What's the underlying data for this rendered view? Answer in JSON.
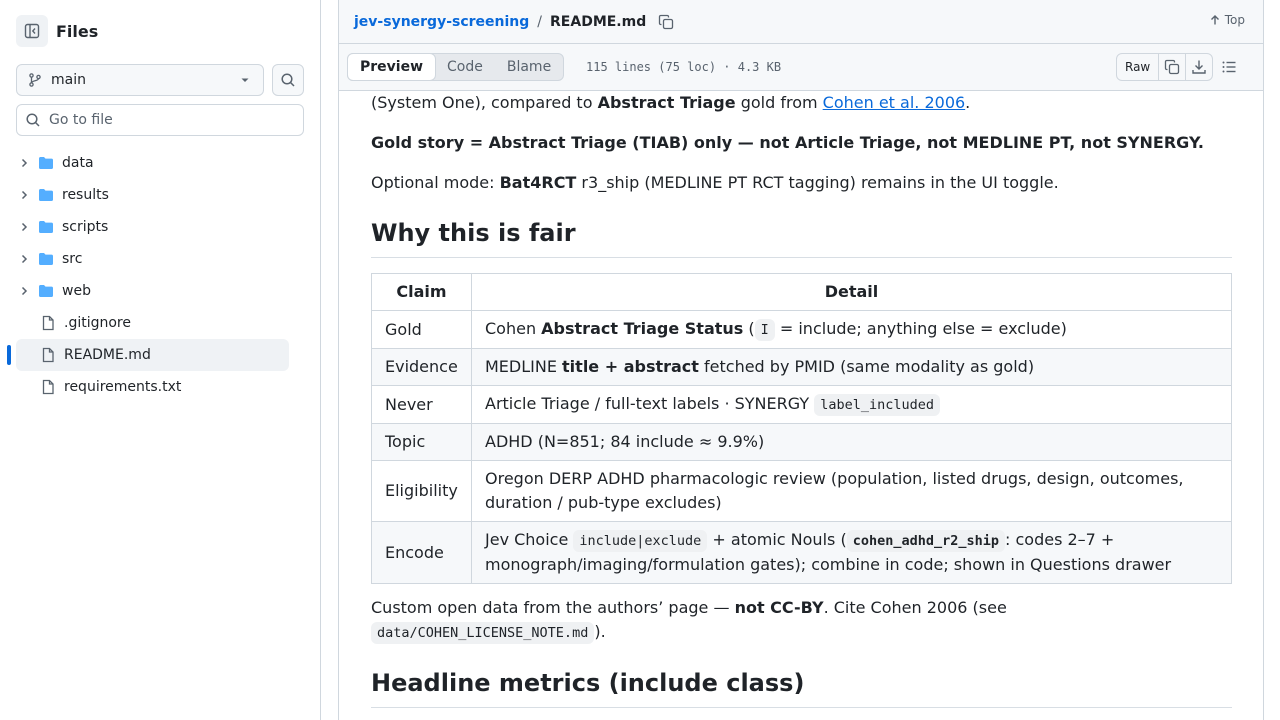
{
  "sidebar": {
    "title": "Files",
    "branch": "main",
    "goto_placeholder": "Go to file",
    "tree": [
      {
        "type": "folder",
        "name": "data"
      },
      {
        "type": "folder",
        "name": "results"
      },
      {
        "type": "folder",
        "name": "scripts"
      },
      {
        "type": "folder",
        "name": "src"
      },
      {
        "type": "folder",
        "name": "web"
      },
      {
        "type": "file",
        "name": ".gitignore"
      },
      {
        "type": "file",
        "name": "README.md",
        "active": true
      },
      {
        "type": "file",
        "name": "requirements.txt"
      }
    ]
  },
  "header": {
    "repo": "jev-synergy-screening",
    "sep": "/",
    "file": "README.md",
    "top": "Top"
  },
  "toolbar": {
    "tabs": [
      "Preview",
      "Code",
      "Blame"
    ],
    "active_tab": "Preview",
    "fileinfo": "115 lines (75 loc) · 4.3 KB",
    "raw": "Raw"
  },
  "readme": {
    "p1": {
      "a": "(System One), compared to ",
      "b": "Abstract Triage",
      "c": " gold from ",
      "link": "Cohen et al. 2006",
      "d": "."
    },
    "p2": "Gold story = Abstract Triage (TIAB) only — not Article Triage, not MEDLINE PT, not SYNERGY.",
    "p3": {
      "a": "Optional mode: ",
      "b": "Bat4RCT",
      "c": " r3_ship (MEDLINE PT RCT tagging) remains in the UI toggle."
    },
    "h_fair": "Why this is fair",
    "table": {
      "headers": [
        "Claim",
        "Detail"
      ],
      "rows": [
        {
          "claim": "Gold",
          "d1": "Cohen ",
          "d2": "Abstract Triage Status",
          "d3": " (",
          "code": "I",
          "d4": " = include; anything else = exclude)"
        },
        {
          "claim": "Evidence",
          "d1": "MEDLINE ",
          "d2": "title + abstract",
          "d3": " fetched by PMID (same modality as gold)"
        },
        {
          "claim": "Never",
          "d1": "Article Triage / full-text labels · SYNERGY ",
          "code": "label_included"
        },
        {
          "claim": "Topic",
          "d1": "ADHD (N=851; 84 include ≈ 9.9%)"
        },
        {
          "claim": "Eligibility",
          "d1": "Oregon DERP ADHD pharmacologic review (population, listed drugs, design, outcomes, duration / pub-type excludes)"
        },
        {
          "claim": "Encode",
          "d1": "Jev Choice ",
          "code1": "include|exclude",
          "d2": " + atomic Nouls (",
          "code2": "cohen_adhd_r2_ship",
          "d3": ": codes 2–7 + monograph/imaging/formulation gates); combine in code; shown in Questions drawer"
        }
      ]
    },
    "p4": {
      "a": "Custom open data from the authors’ page — ",
      "b": "not CC-BY",
      "c": ". Cite Cohen 2006 (see ",
      "code": "data/COHEN_LICENSE_NOTE.md",
      "d": ")."
    },
    "h_metrics": "Headline metrics (include class)"
  }
}
